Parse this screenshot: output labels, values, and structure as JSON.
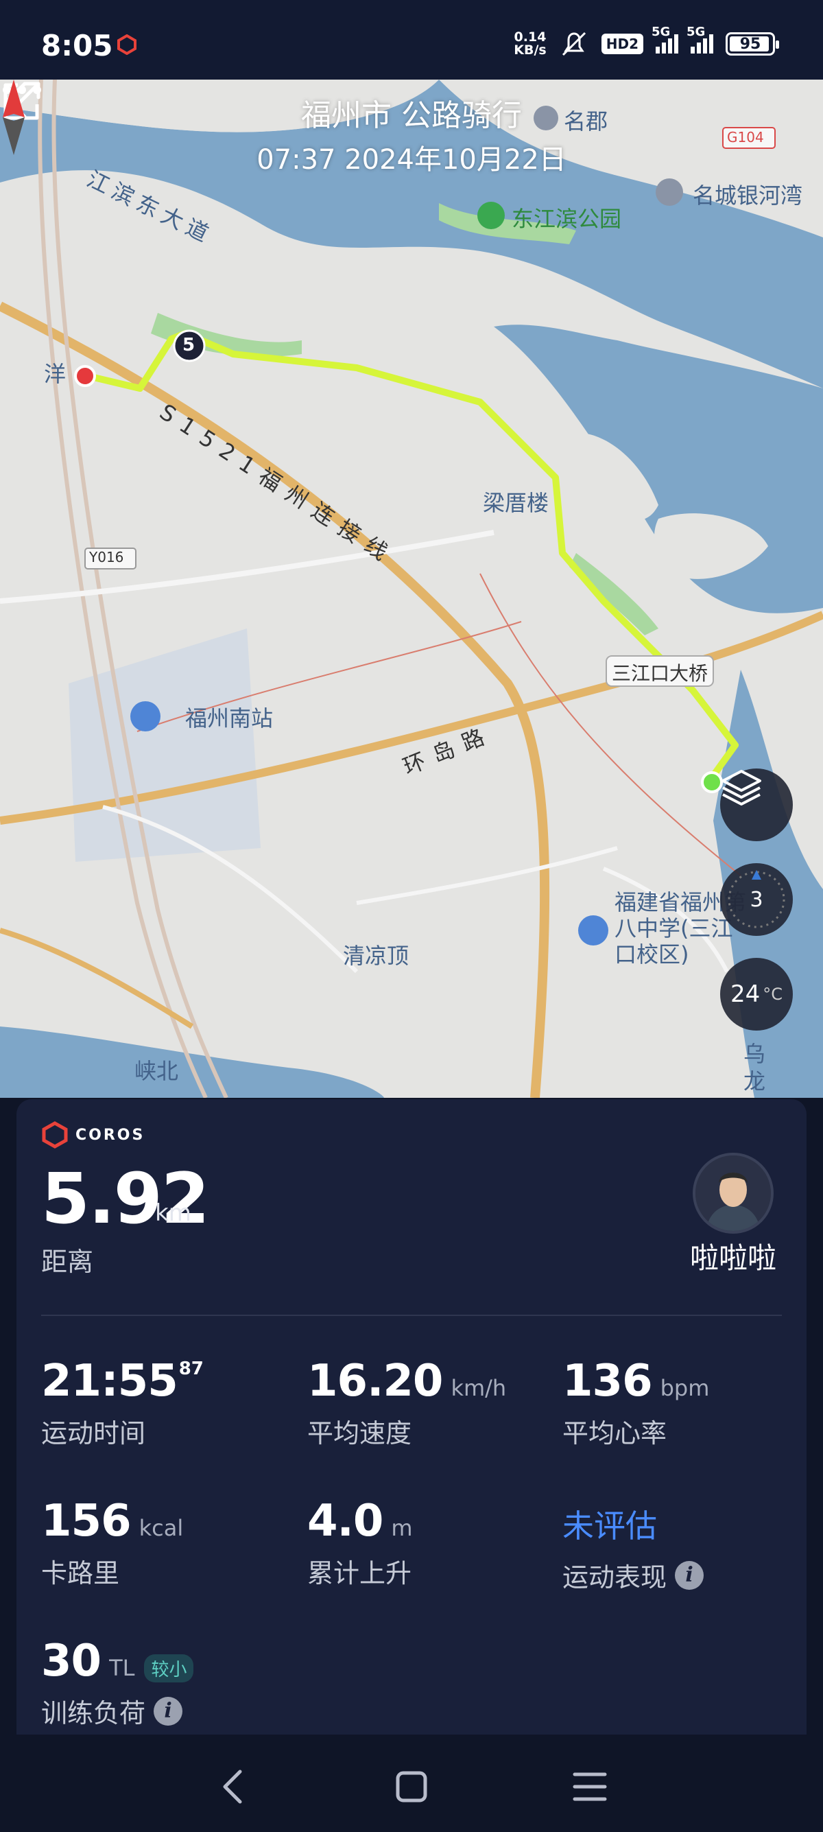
{
  "status_bar": {
    "time": "8:05",
    "net_speed_value": "0.14",
    "net_speed_unit": "KB/s",
    "hd_label": "HD2",
    "signal_1": "5G",
    "signal_2": "5G",
    "battery": "95"
  },
  "header": {
    "title": "福州市 公路骑行",
    "subtitle": "07:37 2024年10月22日"
  },
  "map": {
    "labels": {
      "dongjiang_road": "江滨东大道",
      "mingjun": "名郡",
      "mingcheng": "名城银河湾",
      "dongjiang_park": "东江滨公园",
      "g104": "G104",
      "yang": "洋",
      "lap_marker": "5",
      "s1521": "S1521福州连接线",
      "liangcuo": "梁厝楼",
      "y016": "Y016",
      "sanjiangkou": "三江口大桥",
      "fuzhou_south": "福州南站",
      "huandao": "环岛路",
      "fujian_school": "福建省福州第八中学(三江口校区)",
      "qingliang": "清凉顶",
      "xiabei": "峡北",
      "wulong": "乌龙"
    },
    "level_value": "3",
    "temperature_value": "24",
    "temperature_unit": "°C"
  },
  "panel": {
    "brand": "COROS",
    "distance_value": "5.92",
    "distance_unit": "km",
    "distance_label": "距离",
    "user_name": "啦啦啦",
    "stats": {
      "time_main": "21:55",
      "time_fraction": "87",
      "time_label": "运动时间",
      "speed_value": "16.20",
      "speed_unit": "km/h",
      "speed_label": "平均速度",
      "hr_value": "136",
      "hr_unit": "bpm",
      "hr_label": "平均心率",
      "cal_value": "156",
      "cal_unit": "kcal",
      "cal_label": "卡路里",
      "elev_value": "4.0",
      "elev_unit": "m",
      "elev_label": "累计上升",
      "perf_value": "未评估",
      "perf_label": "运动表现",
      "load_value": "30",
      "load_unit": "TL",
      "load_tag": "较小",
      "load_label": "训练负荷"
    }
  },
  "colors": {
    "route": "#d6f53a",
    "start_dot": "#6fe04a",
    "end_dot": "#e5393c",
    "panel_bg": "#19203a",
    "accent_blue": "#4a8cff",
    "water": "#7ea6c8"
  },
  "icons": {
    "back": "chevron-left-icon",
    "share": "share-icon",
    "more": "more-dots-icon",
    "compass": "compass-icon",
    "layers": "layers-icon",
    "level": "map-level-icon",
    "info": "info-icon"
  }
}
